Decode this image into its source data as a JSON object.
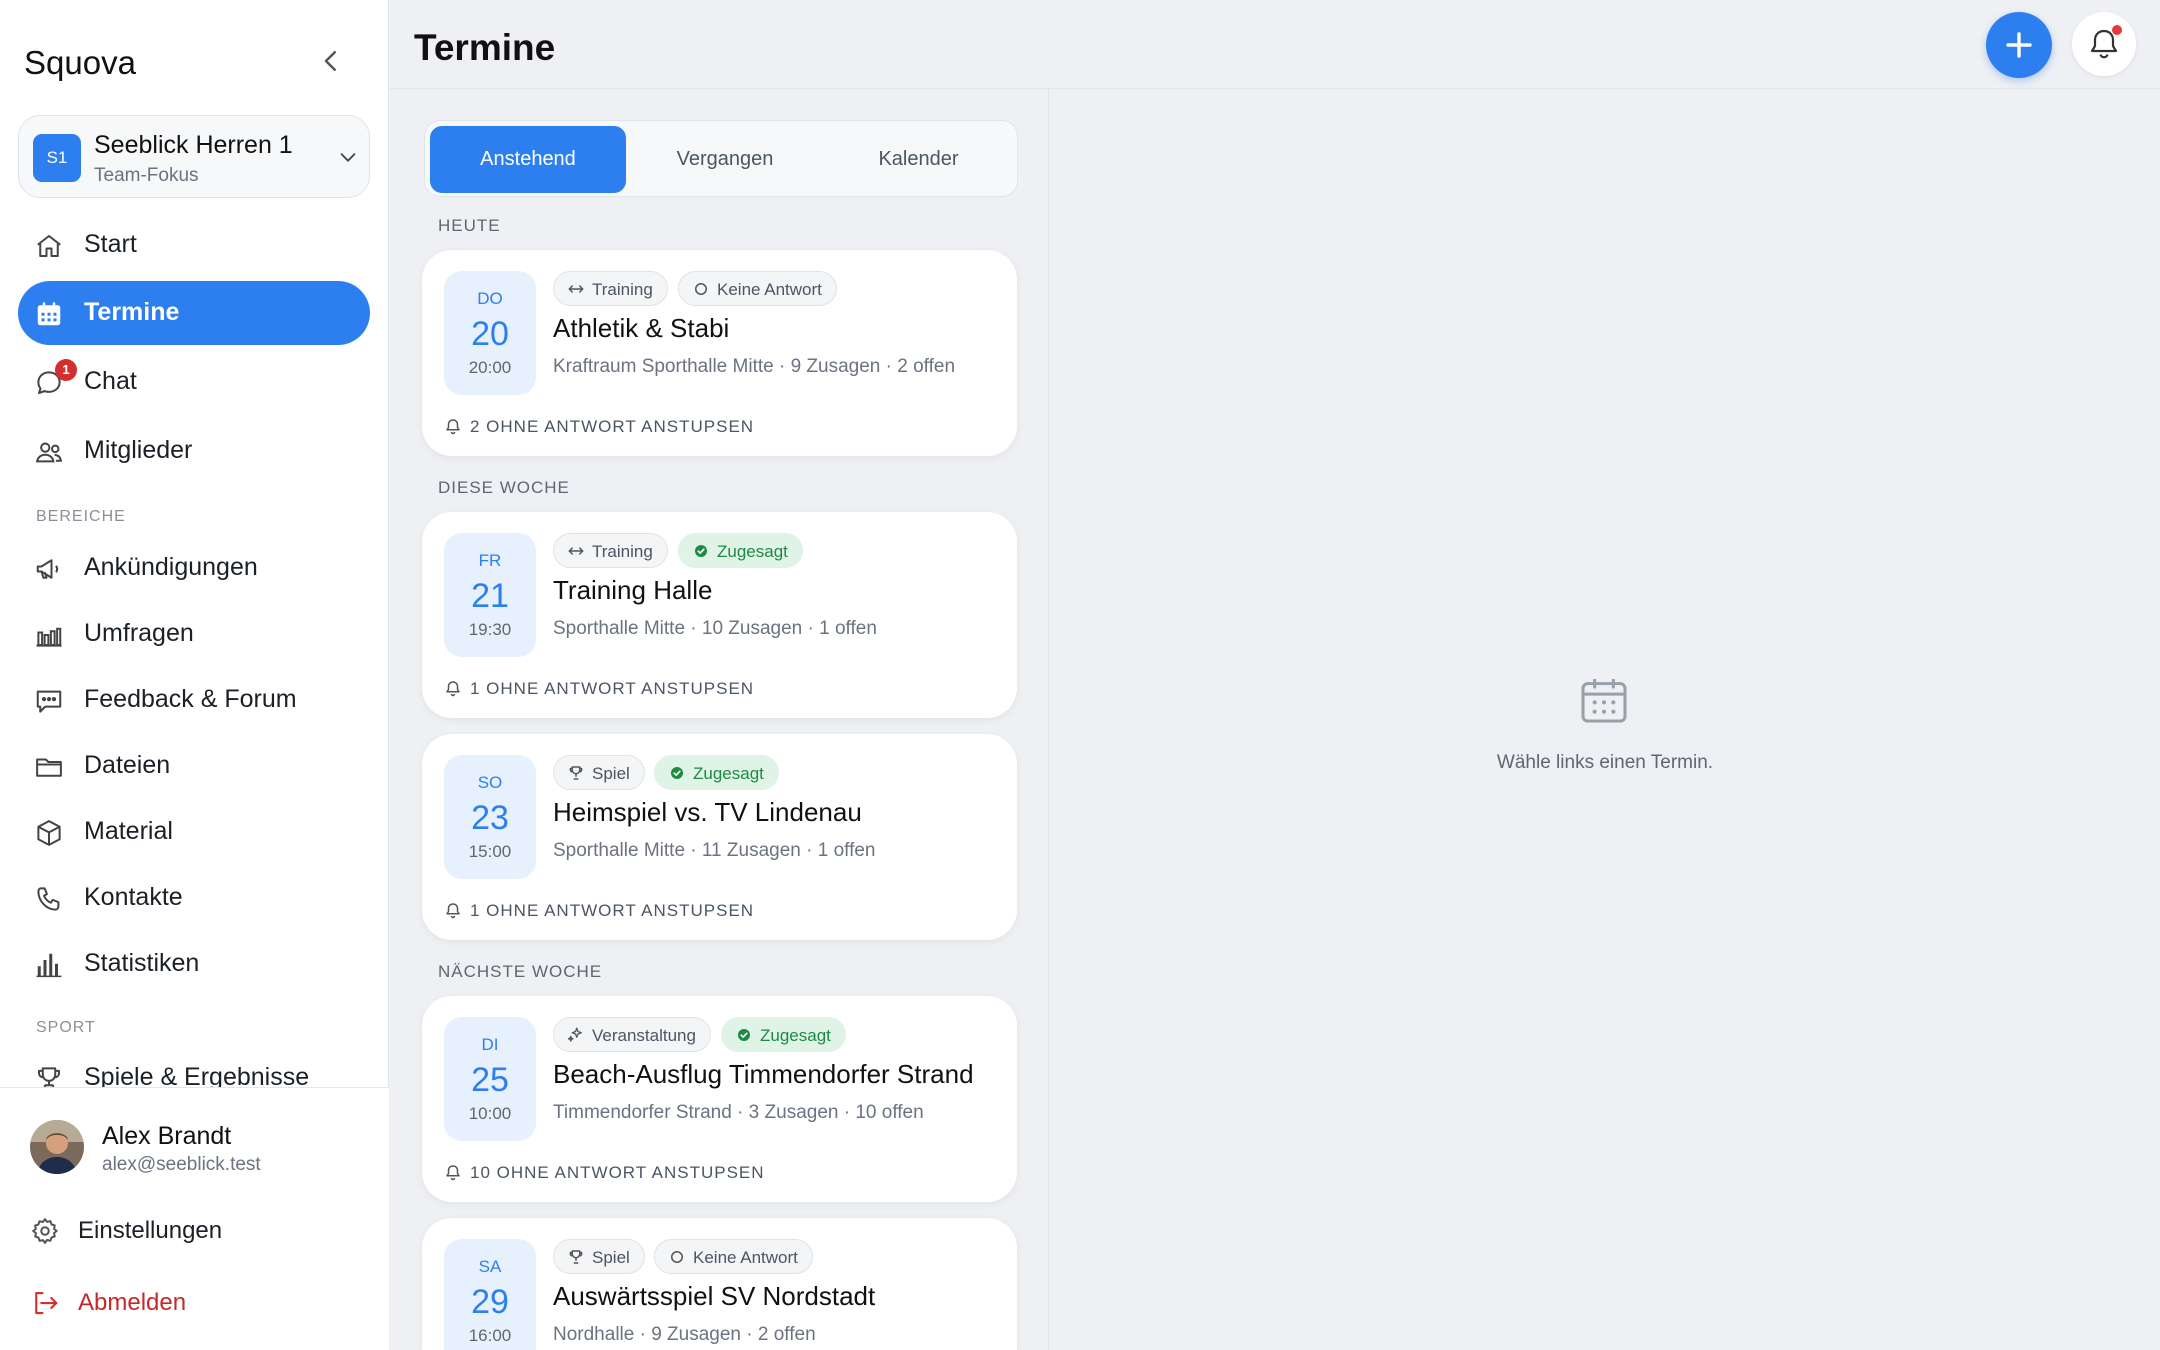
{
  "sidebar": {
    "brand": "Squova",
    "team": {
      "initials": "S1",
      "name": "Seeblick Herren 1",
      "subtitle": "Team-Fokus"
    },
    "nav": [
      {
        "label": "Start",
        "icon": "home-icon"
      },
      {
        "label": "Termine",
        "icon": "calendar-icon",
        "active": true
      },
      {
        "label": "Chat",
        "icon": "chat-icon",
        "badge": "1"
      },
      {
        "label": "Mitglieder",
        "icon": "users-icon"
      }
    ],
    "sections": [
      {
        "label": "BEREICHE"
      },
      {
        "label": "SPORT"
      }
    ],
    "bereiche": [
      {
        "label": "Ankündigungen",
        "icon": "megaphone-icon"
      },
      {
        "label": "Umfragen",
        "icon": "bar-chart-icon"
      },
      {
        "label": "Feedback & Forum",
        "icon": "message-square-icon"
      },
      {
        "label": "Dateien",
        "icon": "folder-icon"
      },
      {
        "label": "Material",
        "icon": "box-icon"
      },
      {
        "label": "Kontakte",
        "icon": "phone-icon"
      },
      {
        "label": "Statistiken",
        "icon": "stats-icon"
      }
    ],
    "sport": [
      {
        "label": "Spiele & Ergebnisse",
        "icon": "trophy-icon"
      }
    ],
    "user": {
      "name": "Alex Brandt",
      "email": "alex@seeblick.test"
    },
    "settings_label": "Einstellungen",
    "logout_label": "Abmelden"
  },
  "header": {
    "title": "Termine"
  },
  "tabs": [
    {
      "label": "Anstehend",
      "active": true
    },
    {
      "label": "Vergangen"
    },
    {
      "label": "Kalender"
    }
  ],
  "groups": [
    {
      "label": "HEUTE"
    },
    {
      "label": "DIESE WOCHE"
    },
    {
      "label": "NÄCHSTE WOCHE"
    }
  ],
  "events": [
    {
      "dow": "DO",
      "day": "20",
      "time": "20:00",
      "type": "Training",
      "type_icon": "arrows-icon",
      "rsvp": "Keine Antwort",
      "rsvp_state": "none",
      "title": "Athletik & Stabi",
      "meta": "Kraftraum Sporthalle Mitte · 9 Zusagen · 2 offen",
      "nudge": "2 OHNE ANTWORT ANSTUPSEN"
    },
    {
      "dow": "FR",
      "day": "21",
      "time": "19:30",
      "type": "Training",
      "type_icon": "arrows-icon",
      "rsvp": "Zugesagt",
      "rsvp_state": "yes",
      "title": "Training Halle",
      "meta": "Sporthalle Mitte · 10 Zusagen · 1 offen",
      "nudge": "1 OHNE ANTWORT ANSTUPSEN"
    },
    {
      "dow": "SO",
      "day": "23",
      "time": "15:00",
      "type": "Spiel",
      "type_icon": "trophy-icon",
      "rsvp": "Zugesagt",
      "rsvp_state": "yes",
      "title": "Heimspiel vs. TV Lindenau",
      "meta": "Sporthalle Mitte · 11 Zusagen · 1 offen",
      "nudge": "1 OHNE ANTWORT ANSTUPSEN"
    },
    {
      "dow": "DI",
      "day": "25",
      "time": "10:00",
      "type": "Veranstaltung",
      "type_icon": "sparkle-icon",
      "rsvp": "Zugesagt",
      "rsvp_state": "yes",
      "title": "Beach-Ausflug Timmendorfer Strand",
      "meta": "Timmendorfer Strand · 3 Zusagen · 10 offen",
      "nudge": "10 OHNE ANTWORT ANSTUPSEN"
    },
    {
      "dow": "SA",
      "day": "29",
      "time": "16:00",
      "type": "Spiel",
      "type_icon": "trophy-icon",
      "rsvp": "Keine Antwort",
      "rsvp_state": "none",
      "title": "Auswärtsspiel SV Nordstadt",
      "meta": "Nordhalle · 9 Zusagen · 2 offen",
      "nudge": ""
    }
  ],
  "detail": {
    "empty_text": "Wähle links einen Termin.",
    "icon": "calendar-icon"
  },
  "colors": {
    "accent": "#2d7ff0",
    "success": "#1e8a44",
    "danger": "#d32f2f"
  }
}
